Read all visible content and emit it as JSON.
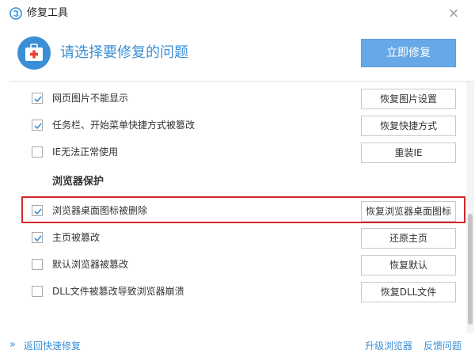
{
  "window": {
    "title": "修复工具",
    "close_symbol": "×"
  },
  "header": {
    "title": "请选择要修复的问题",
    "repair_button": "立即修复",
    "icon": "first-aid-kit-icon"
  },
  "items_top": [
    {
      "checked": true,
      "label": "网页图片不能显示",
      "action": "恢复图片设置"
    },
    {
      "checked": true,
      "label": "任务栏、开始菜单快捷方式被篡改",
      "action": "恢复快捷方式"
    },
    {
      "checked": false,
      "label": "IE无法正常使用",
      "action": "重装IE"
    }
  ],
  "section": {
    "title": "浏览器保护"
  },
  "items_browser": [
    {
      "checked": true,
      "label": "浏览器桌面图标被删除",
      "action": "恢复浏览器桌面图标",
      "highlighted": true
    },
    {
      "checked": true,
      "label": "主页被篡改",
      "action": "还原主页"
    },
    {
      "checked": false,
      "label": "默认浏览器被篡改",
      "action": "恢复默认"
    },
    {
      "checked": false,
      "label": "DLL文件被篡改导致浏览器崩溃",
      "action": "恢复DLL文件"
    }
  ],
  "footer": {
    "back_chevron": "»",
    "back_link": "返回快速修复",
    "upgrade_link": "升级浏览器",
    "feedback_link": "反馈问题"
  },
  "colors": {
    "accent": "#3a8fd6",
    "button_primary": "#67a9e8",
    "highlight_border": "#d2272b",
    "checkmark": "#3a8fd6"
  }
}
